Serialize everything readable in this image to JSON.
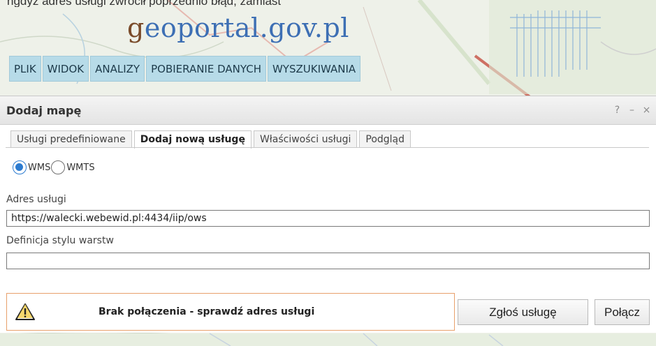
{
  "caption": "ngdyż adres usługi zwrócił poprzednio błąd, zamiast",
  "logo": {
    "g": "g",
    "rest": "eoportal.gov.pl"
  },
  "menu": [
    "PLIK",
    "WIDOK",
    "ANALIZY",
    "POBIERANIE DANYCH",
    "WYSZUKIWANIA"
  ],
  "dialog": {
    "title": "Dodaj mapę",
    "buttons": {
      "help": "?",
      "minimize": "–",
      "close": "×"
    },
    "tabs": [
      "Usługi predefiniowane",
      "Dodaj nową usługę",
      "Właściwości usługi",
      "Podgląd"
    ],
    "active_tab": 1,
    "radios": [
      {
        "label": "WMS",
        "checked": true
      },
      {
        "label": "WMTS",
        "checked": false
      }
    ],
    "address_label": "Adres usługi",
    "address_value": "https://walecki.webewid.pl:4434/iip/ows",
    "style_label": "Definicja stylu warstw",
    "style_value": "",
    "alert": {
      "icon": "warning-icon",
      "text": "Brak połączenia - sprawdź adres usługi"
    },
    "report_button": "Zgłoś usługę",
    "connect_button": "Połącz"
  },
  "colors": {
    "menu_bg": "#b7dbe8",
    "alert_border": "#e8a06c",
    "radio_accent": "#2b7bd0",
    "logo_brown": "#7a4b2a",
    "logo_blue": "#3d6fb4"
  }
}
